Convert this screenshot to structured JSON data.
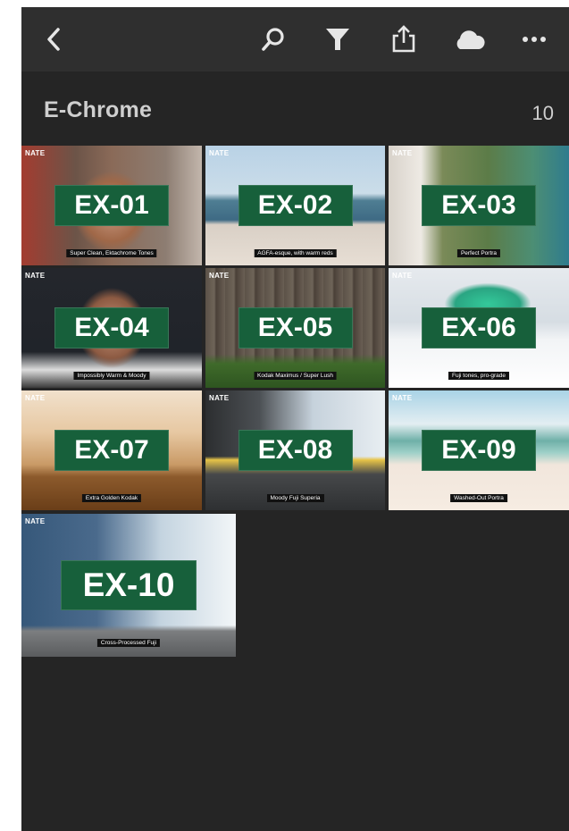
{
  "header": {
    "back_icon": "chevron-left-icon",
    "search_icon": "search-icon",
    "filter_icon": "filter-icon",
    "share_icon": "share-icon",
    "cloud_icon": "cloud-icon",
    "more_icon": "more-icon"
  },
  "album": {
    "title": "E-Chrome",
    "count": "10"
  },
  "presets": [
    {
      "brand": "NATE",
      "code": "EX-01",
      "caption": "Super Clean, Ektachrome Tones"
    },
    {
      "brand": "NATE",
      "code": "EX-02",
      "caption": "AGFA-esque, with warm reds"
    },
    {
      "brand": "NATE",
      "code": "EX-03",
      "caption": "Perfect Portra"
    },
    {
      "brand": "NATE",
      "code": "EX-04",
      "caption": "Impossibly Warm & Moody"
    },
    {
      "brand": "NATE",
      "code": "EX-05",
      "caption": "Kodak Maximus / Super Lush"
    },
    {
      "brand": "NATE",
      "code": "EX-06",
      "caption": "Fuji tones, pro-grade"
    },
    {
      "brand": "NATE",
      "code": "EX-07",
      "caption": "Extra Golden Kodak"
    },
    {
      "brand": "NATE",
      "code": "EX-08",
      "caption": "Moody Fuji Superia"
    },
    {
      "brand": "NATE",
      "code": "EX-09",
      "caption": "Washed-Out Portra"
    },
    {
      "brand": "NATE",
      "code": "EX-10",
      "caption": "Cross-Processed Fuji"
    }
  ],
  "colors": {
    "label_green": "#17603b",
    "background": "#252525",
    "header": "#2f2f2f"
  }
}
